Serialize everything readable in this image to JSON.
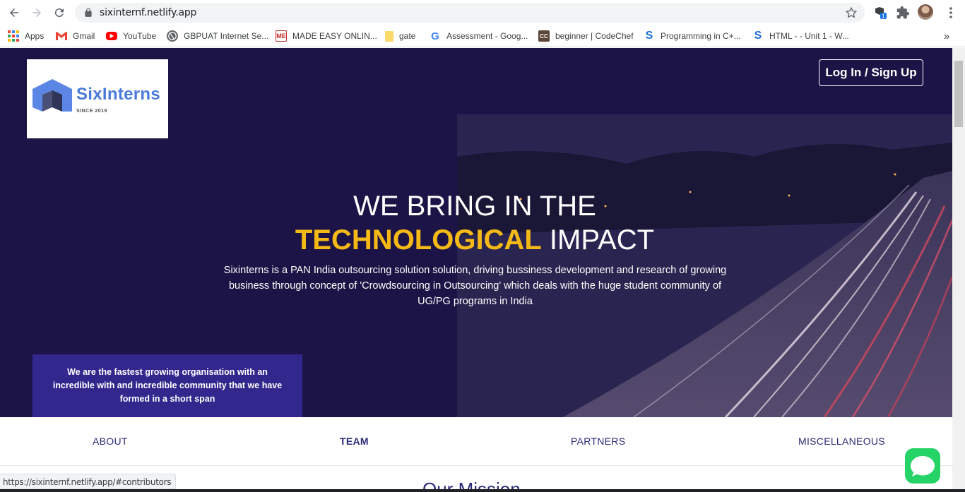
{
  "browser": {
    "url": "sixinternf.netlify.app",
    "bookmarks": [
      {
        "label": "Apps",
        "icon": "apps-grid-icon"
      },
      {
        "label": "Gmail",
        "icon": "gmail-icon"
      },
      {
        "label": "YouTube",
        "icon": "youtube-icon"
      },
      {
        "label": "GBPUAT Internet Se...",
        "icon": "globe-icon"
      },
      {
        "label": "MADE EASY ONLIN...",
        "icon": "madeeasy-icon"
      },
      {
        "label": "gate",
        "icon": "folder-icon"
      },
      {
        "label": "Assessment - Goog...",
        "icon": "google-icon"
      },
      {
        "label": "beginner | CodeChef",
        "icon": "codechef-icon"
      },
      {
        "label": "Programming in C+...",
        "icon": "s-icon"
      },
      {
        "label": "HTML - - Unit 1 - W...",
        "icon": "s-icon"
      }
    ],
    "more_bookmarks": "»",
    "status_url": "https://sixinternf.netlify.app/#contributors"
  },
  "site": {
    "logo_name": "SixInterns",
    "logo_since": "SINCE 2019",
    "login_label": "Log In / Sign Up",
    "headline_line1": "WE BRING IN THE",
    "headline_accent": "TECHNOLOGICAL",
    "headline_rest": " IMPACT",
    "description": "Sixinterns is a PAN India outsourcing solution solution, driving bussiness development and research of growing business through concept of 'Crowdsourcing in Outsourcing' which deals with the huge student community of UG/PG programs in India",
    "card_text": "We are the fastest growing organisation with an incredible with and incredible community that we have formed in a short span",
    "nav": [
      {
        "label": "ABOUT",
        "active": false
      },
      {
        "label": "TEAM",
        "active": true
      },
      {
        "label": "PARTNERS",
        "active": false
      },
      {
        "label": "MISCELLANEOUS",
        "active": false
      }
    ],
    "section_title": "Our Mission"
  },
  "colors": {
    "hero_bg": "#1c1446",
    "accent_yellow": "#f5b916",
    "card_bg": "#32278c",
    "nav_text": "#2b2a7a",
    "chat_green": "#25d366"
  }
}
